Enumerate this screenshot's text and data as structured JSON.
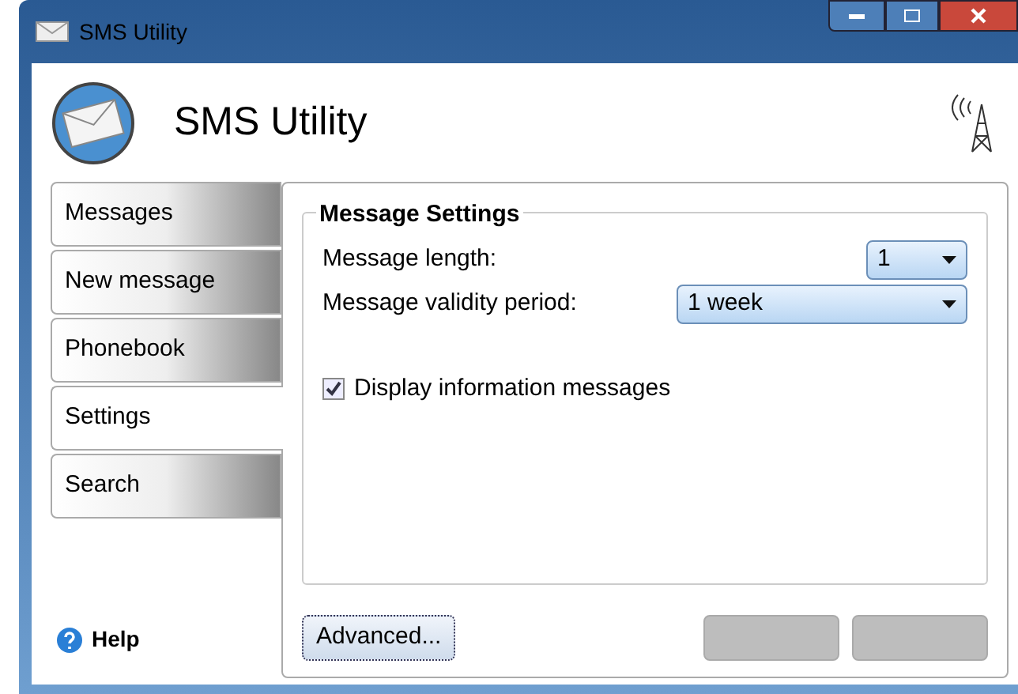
{
  "window": {
    "title": "SMS Utility"
  },
  "header": {
    "title": "SMS Utility"
  },
  "tabs": [
    {
      "label": "Messages",
      "selected": false
    },
    {
      "label": "New message",
      "selected": false
    },
    {
      "label": "Phonebook",
      "selected": false
    },
    {
      "label": "Settings",
      "selected": true
    },
    {
      "label": "Search",
      "selected": false
    }
  ],
  "help": {
    "label": "Help"
  },
  "group": {
    "title": "Message Settings",
    "fields": [
      {
        "label": "Message length:",
        "value": "1",
        "kind": "short"
      },
      {
        "label": "Message validity period:",
        "value": "1 week",
        "kind": "wide"
      }
    ],
    "checkbox": {
      "label": "Display information messages",
      "checked": true
    }
  },
  "buttons": [
    {
      "label": "Advanced...",
      "disabled": false
    },
    {
      "disabled": true
    },
    {
      "disabled": true
    }
  ]
}
